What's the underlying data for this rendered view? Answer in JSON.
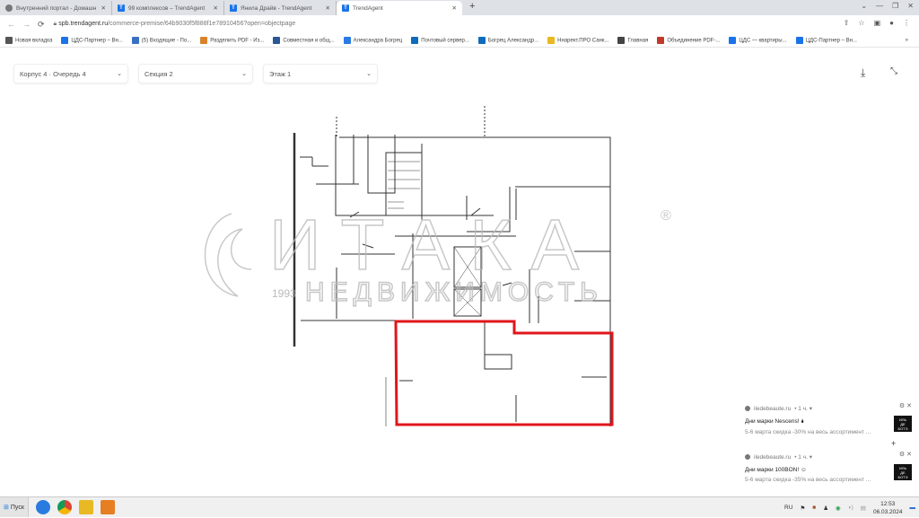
{
  "browser": {
    "tabs": [
      {
        "title": "Внутренний портал - Домашн",
        "icon": "globe-icon",
        "active": false
      },
      {
        "title": "99 комплексов – TrendAgent",
        "icon": "trendagent-icon",
        "active": false
      },
      {
        "title": "Янила Драйв - TrendAgent",
        "icon": "trendagent-icon",
        "active": false
      },
      {
        "title": "TrendAgent",
        "icon": "trendagent-icon",
        "active": true
      }
    ],
    "new_tab": "+",
    "url_host": "spb.trendagent.ru",
    "url_path": "/commerce-premise/64b9030f5f888f1e78910456?open=objectpage",
    "bookmarks": [
      {
        "label": "Новая вкладка",
        "color": "#555555"
      },
      {
        "label": "ЦДС-Партнер – Вн...",
        "color": "#1a73e8"
      },
      {
        "label": "(5) Входящие - По...",
        "color": "#3b6fc4"
      },
      {
        "label": "Разделить PDF - Из...",
        "color": "#d9822b"
      },
      {
        "label": "Совместная и общ...",
        "color": "#2b5797"
      },
      {
        "label": "Александра Богрец",
        "color": "#2a7ae2"
      },
      {
        "label": "Почтовый сервер...",
        "color": "#0f6cbd"
      },
      {
        "label": "Богрец Александр...",
        "color": "#0f6cbd"
      },
      {
        "label": "Ннарект.ПРО Санк...",
        "color": "#e8b923"
      },
      {
        "label": "Главная",
        "color": "#444444"
      },
      {
        "label": "Объединение PDF-...",
        "color": "#c0392b"
      },
      {
        "label": "ЦДС — квартиры...",
        "color": "#1a73e8"
      },
      {
        "label": "ЦДС-Партнер – Вн...",
        "color": "#1a73e8"
      }
    ],
    "bookmarks_more": "»"
  },
  "filters": {
    "building": "Корпус 4 · Очередь 4",
    "section": "Секция 2",
    "floor": "Этаж 1"
  },
  "plan": {
    "highlight_color": "#e0161b",
    "watermark_brand": "ИТАКА",
    "watermark_sub": "НЕДВИЖИМОСТЬ",
    "watermark_year": "1993"
  },
  "notifications": [
    {
      "source": "iledebeaute.ru",
      "age": "• 1 ч. ▾",
      "title": "Дни марки Nescens! 🌢",
      "body": "5-6 марта скидка -30% на весь ассортимент ..."
    },
    {
      "source": "iledebeaute.ru",
      "age": "• 1 ч. ▾",
      "title": "Дни марки 100BON! ☺",
      "body": "5-6 марта скидка -35% на весь ассортимент ..."
    }
  ],
  "taskbar": {
    "start": "Пуск",
    "lang": "RU",
    "time": "12:53",
    "date": "06.03.2024"
  }
}
